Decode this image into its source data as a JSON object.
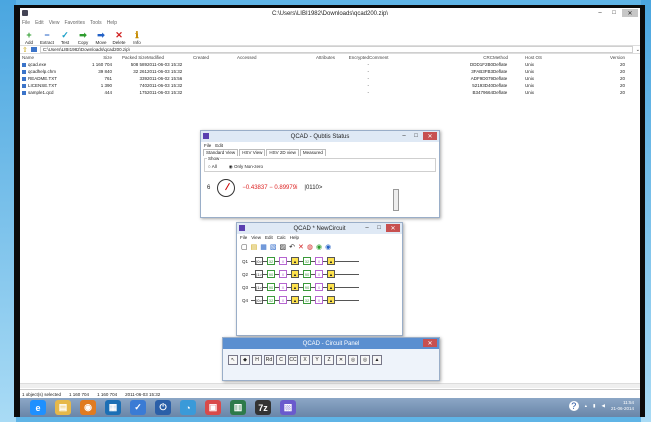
{
  "main": {
    "title": "C:\\Users\\LIBI1982\\Downloads\\qcad200.zip\\",
    "menus": [
      "File",
      "Edit",
      "View",
      "Favorites",
      "Tools",
      "Help"
    ],
    "toolbar": [
      {
        "label": "Add",
        "glyph": "+",
        "color": "#2e9c2e"
      },
      {
        "label": "Extract",
        "glyph": "−",
        "color": "#2361c6"
      },
      {
        "label": "Test",
        "glyph": "✓",
        "color": "#1aa0c8"
      },
      {
        "label": "Copy",
        "glyph": "➡",
        "color": "#2e9c2e"
      },
      {
        "label": "Move",
        "glyph": "➡",
        "color": "#2361c6"
      },
      {
        "label": "Delete",
        "glyph": "✕",
        "color": "#d02020"
      },
      {
        "label": "Info",
        "glyph": "ℹ",
        "color": "#c58a00"
      }
    ],
    "path": "C:\\Users\\LIBI1982\\Downloads\\qcad200.zip\\",
    "columns": [
      "Name",
      "Size",
      "Packed Size",
      "Modified",
      "Created",
      "Accessed",
      "Attributes",
      "Encrypted",
      "Comment",
      "CRC",
      "Method",
      "Host OS",
      "Version"
    ],
    "files": [
      {
        "name": "qcad.exe",
        "size": "1 160 704",
        "packed": "508 589",
        "modified": "2011-06-03 15:32",
        "encrypted": "-",
        "crc": "DDD1F2B0",
        "method": "Deflate",
        "host": "Unix",
        "version": "20"
      },
      {
        "name": "qcadhelp.chm",
        "size": "39 840",
        "packed": "32 261",
        "modified": "2011-06-03 15:32",
        "encrypted": "-",
        "crc": "3FAB3FB3",
        "method": "Deflate",
        "host": "Unix",
        "version": "20"
      },
      {
        "name": "README.TXT",
        "size": "761",
        "packed": "339",
        "modified": "2011-06-02 15:56",
        "encrypted": "-",
        "crc": "ADF9D079",
        "method": "Deflate",
        "host": "Unix",
        "version": "20"
      },
      {
        "name": "LICENSE.TXT",
        "size": "1 390",
        "packed": "740",
        "modified": "2011-06-03 15:32",
        "encrypted": "-",
        "crc": "52193D40",
        "method": "Deflate",
        "host": "Unix",
        "version": "20"
      },
      {
        "name": "sample1.qcd",
        "size": "444",
        "packed": "175",
        "modified": "2011-06-03 15:32",
        "encrypted": "-",
        "crc": "B3479664",
        "method": "Deflate",
        "host": "Unix",
        "version": "20"
      }
    ],
    "status": {
      "selected": "1 object(s) selected",
      "size": "1 160 704",
      "packed": "1 160 704",
      "date": "2011-06-03 15:32"
    }
  },
  "qubit_status": {
    "title": "QCAD - Qubtis Status",
    "menus": [
      "File",
      "Edit"
    ],
    "tabs": [
      "Standard View",
      "HSV View",
      "HSV 2D view",
      "Measured"
    ],
    "show_label": "Show",
    "radio_all": "All",
    "radio_nonzero": "Only Non-zero",
    "index": "6",
    "amplitude": "−0.43837 − 0.89979i",
    "ket": "|0110>"
  },
  "new_circuit": {
    "title": "QCAD * NewCircuit",
    "menus": [
      "File",
      "View",
      "Edit",
      "Calc",
      "Help"
    ],
    "qubits": [
      {
        "label": "Q1",
        "gates": [
          "|0>",
          "32",
          "X",
          "▲",
          "32",
          "X",
          "▲"
        ]
      },
      {
        "label": "Q2",
        "gates": [
          "|1>",
          "90",
          "X",
          "▲",
          "90",
          "X",
          "▲"
        ]
      },
      {
        "label": "Q3",
        "gates": [
          "|1>",
          "90",
          "X",
          "▲",
          "90",
          "X",
          "▲"
        ]
      },
      {
        "label": "Q4",
        "gates": [
          "|0>",
          "32",
          "X",
          "▲",
          "32",
          "X",
          "▲"
        ]
      }
    ]
  },
  "circuit_panel": {
    "title": "QCAD - Circuit Panel",
    "tools": [
      "↖",
      "◆",
      "H",
      "Rd",
      "C",
      "CC",
      "X",
      "Y",
      "Z",
      "✕",
      "◎",
      "◎",
      "▲"
    ]
  },
  "taskbar": {
    "apps": [
      {
        "name": "ie",
        "glyph": "e",
        "color": "#1e90ff"
      },
      {
        "name": "explorer",
        "glyph": "▤",
        "color": "#e6b84a"
      },
      {
        "name": "media",
        "glyph": "◉",
        "color": "#e07b20"
      },
      {
        "name": "app4",
        "glyph": "▦",
        "color": "#1b6fb5"
      },
      {
        "name": "app5",
        "glyph": "✓",
        "color": "#3a7bd5"
      },
      {
        "name": "app6",
        "glyph": "⏻",
        "color": "#2b5fa8"
      },
      {
        "name": "app7",
        "glyph": "◔",
        "color": "#3a9ad9"
      },
      {
        "name": "app8",
        "glyph": "▣",
        "color": "#d94a4a"
      },
      {
        "name": "app9",
        "glyph": "▥",
        "color": "#2d7a4a"
      },
      {
        "name": "7zip",
        "glyph": "7z",
        "color": "#333"
      },
      {
        "name": "qcad",
        "glyph": "▧",
        "color": "#6a5acd"
      }
    ],
    "time": "11:54",
    "date": "21-06-2014"
  }
}
